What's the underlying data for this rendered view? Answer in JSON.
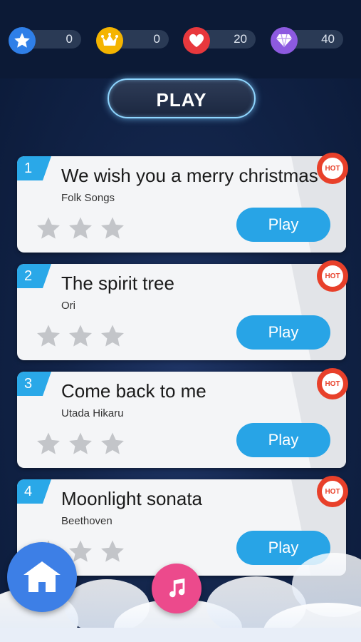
{
  "stats": [
    {
      "icon": "star-icon",
      "value": "0",
      "color": "#2f7fe8"
    },
    {
      "icon": "crown-icon",
      "value": "0",
      "color": "#f4b400"
    },
    {
      "icon": "heart-icon",
      "value": "20",
      "color": "#e8383d"
    },
    {
      "icon": "diamond-icon",
      "value": "40",
      "color": "#8d5ae0"
    }
  ],
  "play_main_label": "PLAY",
  "hot_label": "HOT",
  "songs": [
    {
      "rank": "1",
      "title": "We wish you a merry christmas",
      "artist": "Folk Songs",
      "play_label": "Play",
      "stars": 0
    },
    {
      "rank": "2",
      "title": "The spirit tree",
      "artist": "Ori",
      "play_label": "Play",
      "stars": 0
    },
    {
      "rank": "3",
      "title": "Come back to me",
      "artist": "Utada Hikaru",
      "play_label": "Play",
      "stars": 0
    },
    {
      "rank": "4",
      "title": "Moonlight sonata",
      "artist": "Beethoven",
      "play_label": "Play",
      "stars": 0
    }
  ],
  "colors": {
    "accent": "#28a4e6",
    "hot": "#e8402a",
    "home": "#3d7fe6",
    "music": "#ec4a8c"
  }
}
